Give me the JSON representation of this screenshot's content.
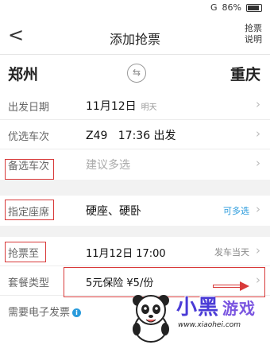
{
  "status": {
    "battery": "86%",
    "network": "G"
  },
  "header": {
    "back_label": "<",
    "title": "添加抢票",
    "help_line1": "抢票",
    "help_line2": "说明"
  },
  "route": {
    "from": "郑州",
    "to": "重庆",
    "swap_icon": "swap-icon"
  },
  "rows": {
    "date": {
      "label": "出发日期",
      "value": "11月12日",
      "sub": "明天"
    },
    "train": {
      "label": "优选车次",
      "value": "Z49   17:36 出发"
    },
    "backup": {
      "label": "备选车次",
      "placeholder": "建议多选"
    },
    "seat": {
      "label": "指定座席",
      "value": "硬座、硬卧",
      "action": "可多选"
    },
    "grab": {
      "label": "抢票至",
      "value": "11月12日 17:00",
      "action": "发车当天"
    },
    "package": {
      "label": "套餐类型",
      "value": "5元保险 ¥5/份"
    },
    "invoice": {
      "label": "需要电子发票"
    }
  },
  "watermark": {
    "title": "小黑",
    "game": "游戏",
    "url": "www.xiaohei.com"
  },
  "colors": {
    "highlight": "#d83a3a",
    "accent": "#2a9bdc"
  }
}
